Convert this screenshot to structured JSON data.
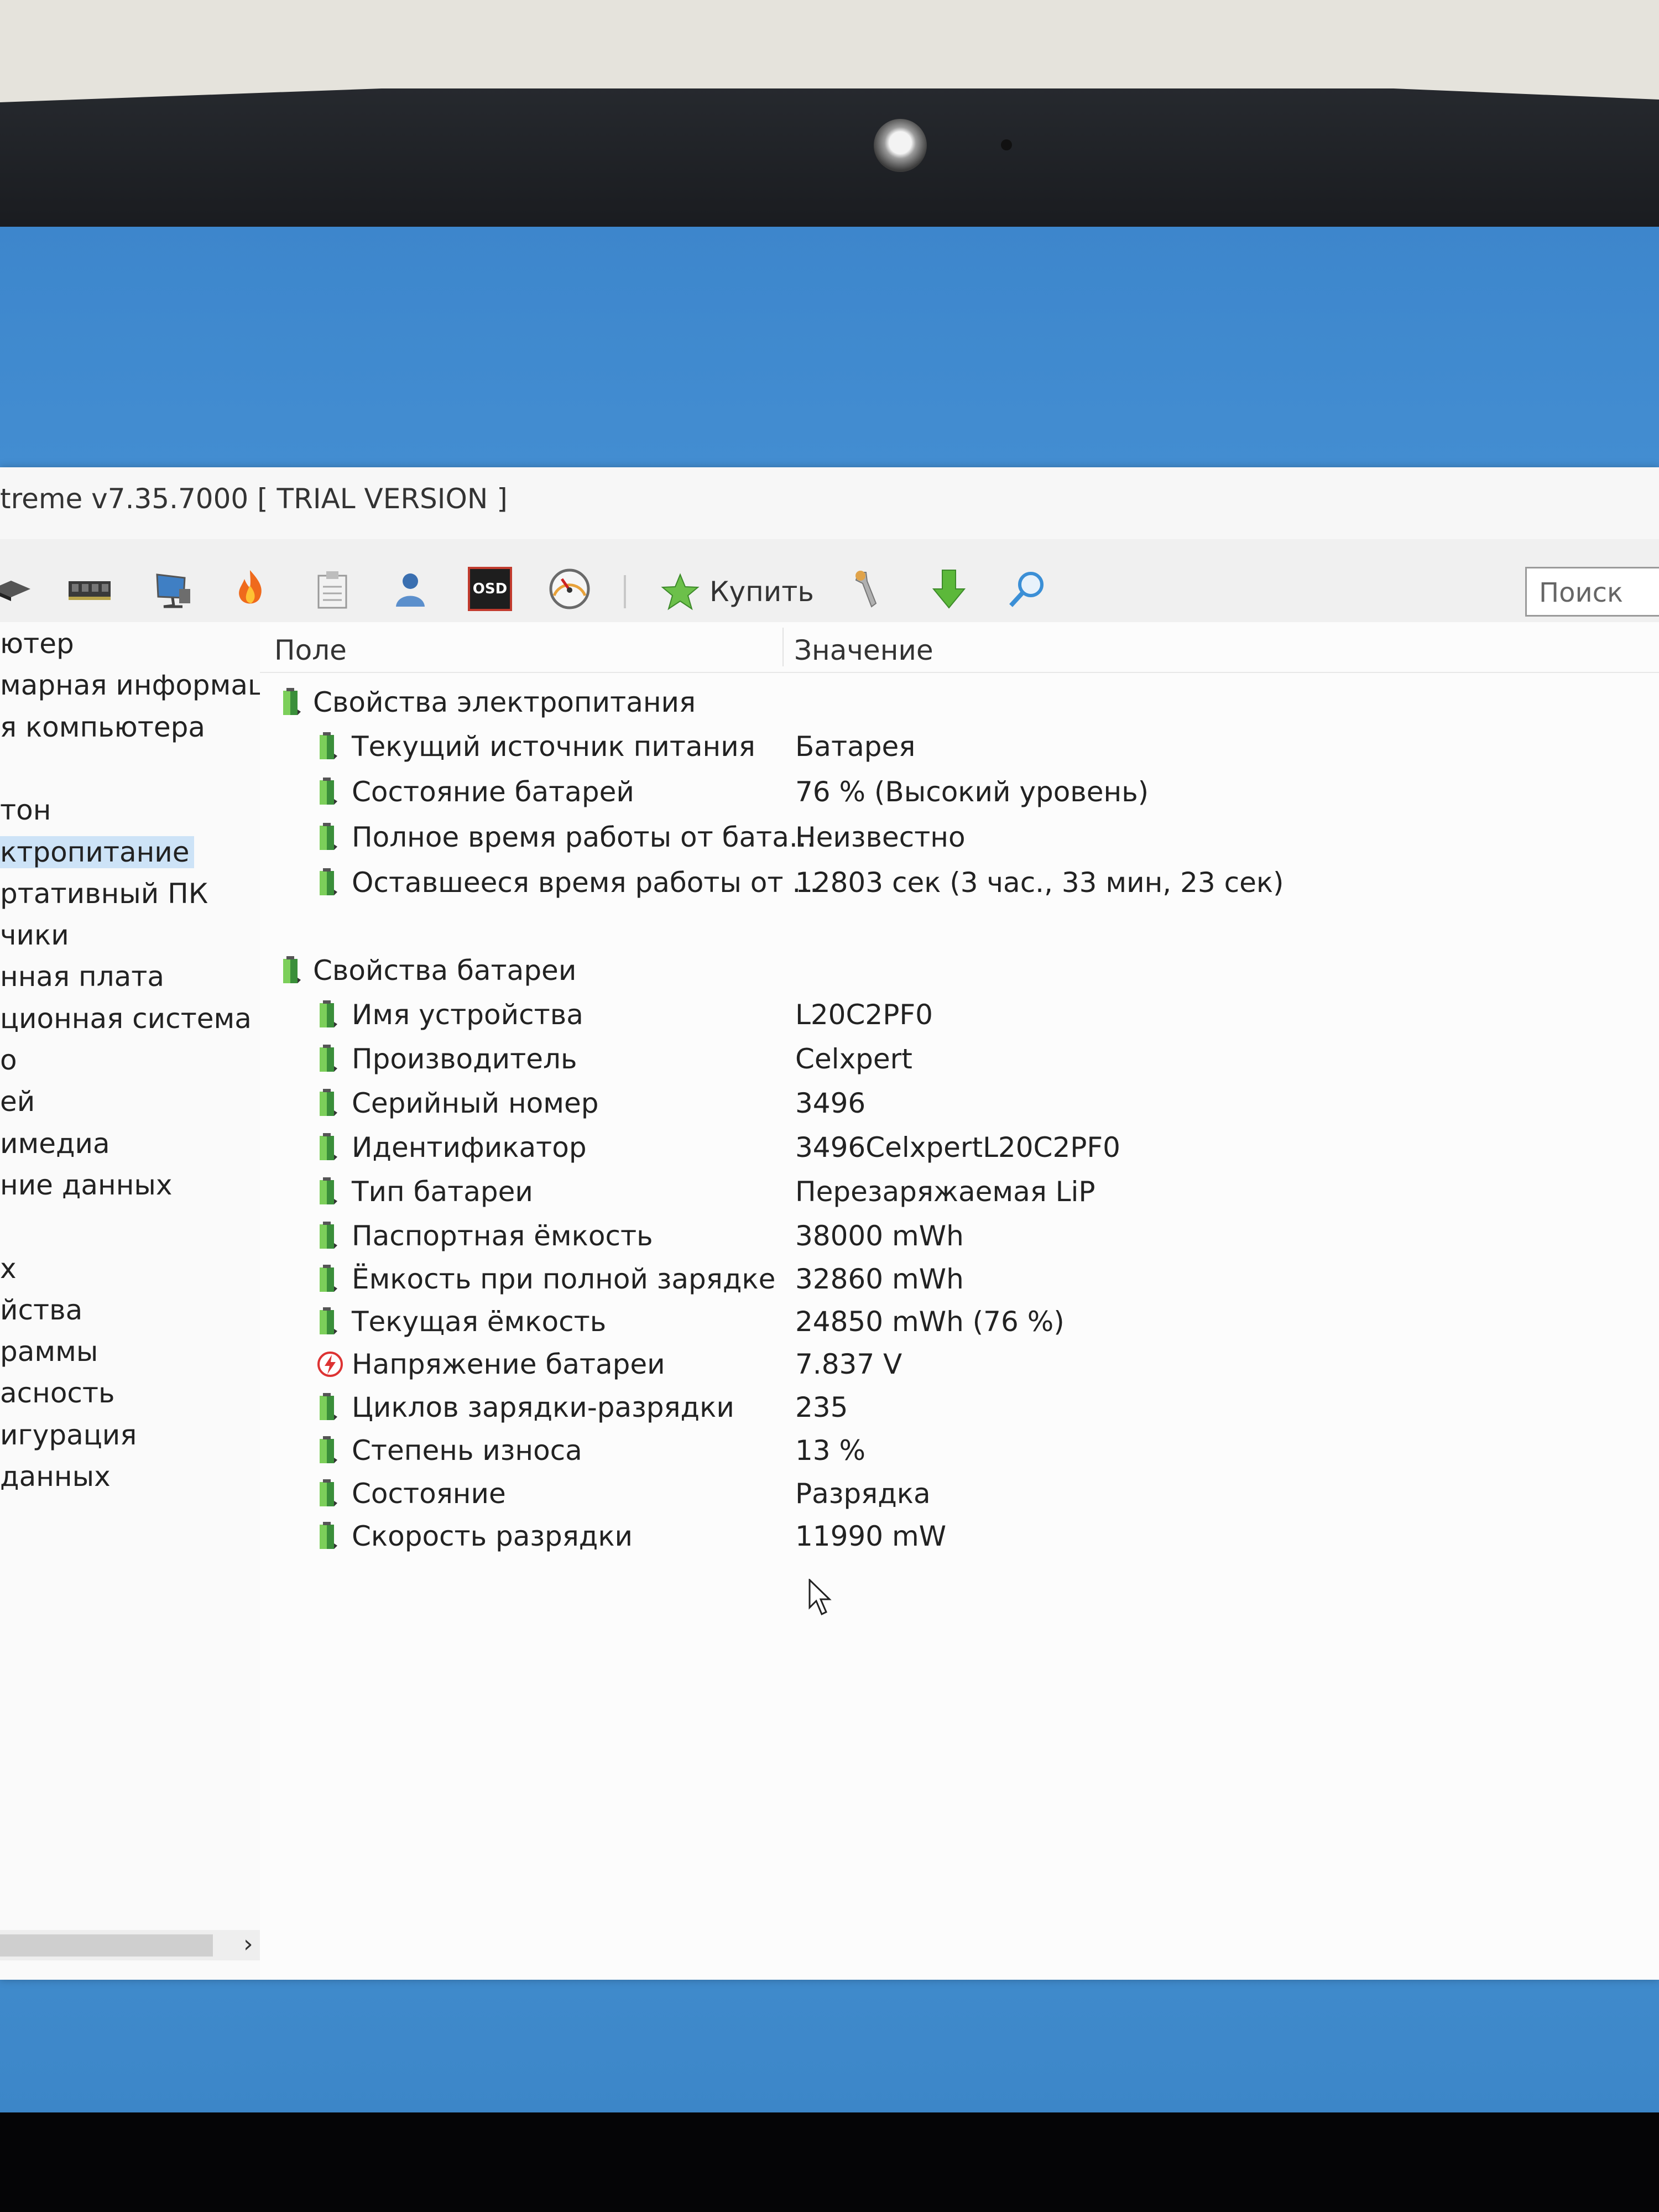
{
  "window": {
    "title": "treme v7.35.7000  [ TRIAL VERSION ]"
  },
  "toolbar": {
    "icons": [
      "motherboard-icon",
      "memory-icon",
      "computer-monitor-icon",
      "flame-icon",
      "clipboard-icon",
      "user-icon",
      "osd-icon",
      "gauge-icon"
    ],
    "osd_label": "OSD",
    "buy_label": "Купить",
    "search_placeholder": "Поиск"
  },
  "sidebar": {
    "items": [
      {
        "label": "ютер"
      },
      {
        "label": "марная информаци"
      },
      {
        "label": "я компьютера"
      },
      {
        "label": ""
      },
      {
        "label": "тон"
      },
      {
        "label": "ктропитание",
        "selected": true
      },
      {
        "label": "ртативный ПК"
      },
      {
        "label": "чики"
      },
      {
        "label": "нная плата"
      },
      {
        "label": "ционная система"
      },
      {
        "label": "о"
      },
      {
        "label": "ей"
      },
      {
        "label": "имедиа"
      },
      {
        "label": "ние данных"
      },
      {
        "label": ""
      },
      {
        "label": "х"
      },
      {
        "label": "йства"
      },
      {
        "label": "раммы"
      },
      {
        "label": "асность"
      },
      {
        "label": "игурация"
      },
      {
        "label": "данных"
      }
    ]
  },
  "table": {
    "col_field": "Поле",
    "col_value": "Значение",
    "groups": [
      {
        "title": "Свойства электропитания",
        "rows": [
          {
            "field": "Текущий источник питания",
            "value": "Батарея",
            "icon": "battery-icon"
          },
          {
            "field": "Состояние батарей",
            "value": "76 % (Высокий уровень)",
            "icon": "battery-icon"
          },
          {
            "field": "Полное время работы от бата...",
            "value": "Неизвестно",
            "icon": "battery-icon"
          },
          {
            "field": "Оставшееся время работы от ...",
            "value": "12803 сек (3 час., 33 мин, 23 сек)",
            "icon": "battery-icon"
          }
        ]
      },
      {
        "title": "Свойства батареи",
        "rows": [
          {
            "field": "Имя устройства",
            "value": "L20C2PF0",
            "icon": "battery-icon"
          },
          {
            "field": "Производитель",
            "value": "Celxpert",
            "icon": "battery-icon"
          },
          {
            "field": "Серийный номер",
            "value": "3496",
            "icon": "battery-icon"
          },
          {
            "field": "Идентификатор",
            "value": "3496CelxpertL20C2PF0",
            "icon": "battery-icon"
          },
          {
            "field": "Тип батареи",
            "value": "Перезаряжаемая LiP",
            "icon": "battery-icon"
          },
          {
            "field": "Паспортная ёмкость",
            "value": "38000 mWh",
            "icon": "battery-icon"
          },
          {
            "field": "Ёмкость при полной зарядке",
            "value": "32860 mWh",
            "icon": "battery-icon"
          },
          {
            "field": "Текущая ёмкость",
            "value": "24850 mWh  (76 %)",
            "icon": "battery-icon"
          },
          {
            "field": "Напряжение батареи",
            "value": "7.837 V",
            "icon": "voltage-icon"
          },
          {
            "field": "Циклов зарядки-разрядки",
            "value": "235",
            "icon": "battery-icon"
          },
          {
            "field": "Степень износа",
            "value": "13 %",
            "icon": "battery-icon"
          },
          {
            "field": "Состояние",
            "value": "Разрядка",
            "icon": "battery-icon"
          },
          {
            "field": "Скорость разрядки",
            "value": "11990 mW",
            "icon": "battery-icon"
          }
        ]
      }
    ]
  }
}
